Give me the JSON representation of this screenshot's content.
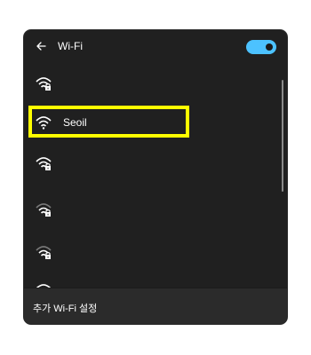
{
  "panel": {
    "title": "Wi-Fi",
    "back_icon": "back-arrow-icon",
    "wifi_enabled": true
  },
  "networks": [
    {
      "name": "",
      "secured": true
    },
    {
      "name": "Seoil",
      "secured": false,
      "highlighted": true
    },
    {
      "name": "",
      "secured": true
    },
    {
      "name": "",
      "secured": true
    },
    {
      "name": "",
      "secured": true
    }
  ],
  "footer": {
    "label": "추가 Wi-Fi 설정"
  },
  "colors": {
    "accent": "#4cc2ff",
    "highlight": "#ffff00",
    "panel_bg": "#202020"
  }
}
